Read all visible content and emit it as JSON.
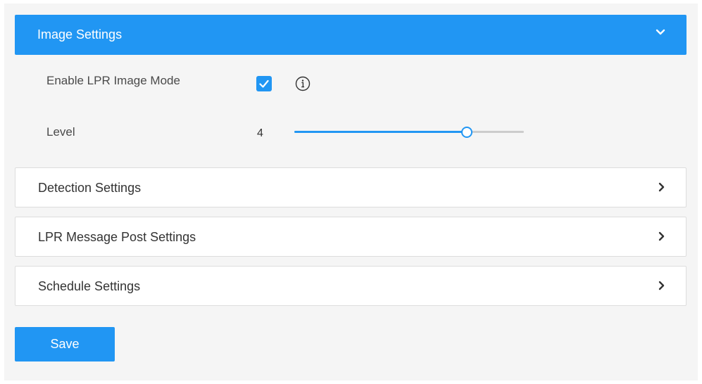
{
  "image_settings": {
    "title": "Image Settings",
    "expanded": true,
    "header_color": "#2196f3",
    "collapse_icon": "chevron-down-icon",
    "enable_lpr": {
      "label": "Enable LPR Image Mode",
      "checked": true,
      "info_icon": "info-icon"
    },
    "level": {
      "label": "Level",
      "value": "4",
      "slider_fraction": 0.75
    }
  },
  "sections": [
    {
      "title": "Detection Settings",
      "icon": "chevron-right-icon"
    },
    {
      "title": "LPR Message Post Settings",
      "icon": "chevron-right-icon"
    },
    {
      "title": "Schedule Settings",
      "icon": "chevron-right-icon"
    }
  ],
  "save_button": {
    "label": "Save",
    "color": "#2196f3"
  }
}
